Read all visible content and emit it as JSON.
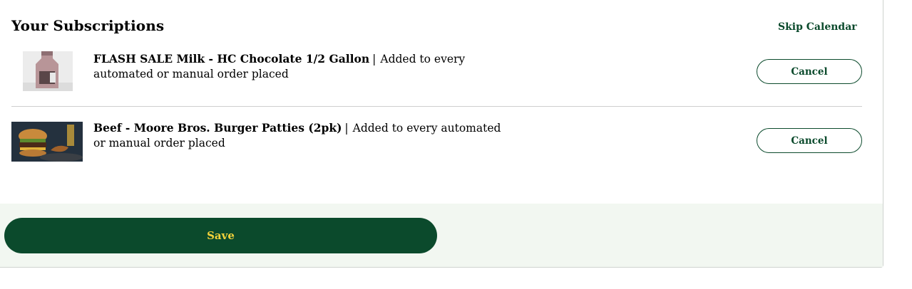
{
  "header": {
    "title": "Your Subscriptions",
    "skip_calendar_label": "Skip Calendar"
  },
  "subscriptions": [
    {
      "product_name": "FLASH SALE Milk - HC Chocolate 1/2 Gallon",
      "separator": "|",
      "frequency_line1": "Added to every",
      "frequency_line2": "automated or manual order placed",
      "cancel_label": "Cancel",
      "image_icon": "milk-jug-photo"
    },
    {
      "product_name": "Beef - Moore Bros. Burger Patties (2pk)",
      "separator": "|",
      "frequency_line1": "Added to every automated",
      "frequency_line2": "or manual order placed",
      "cancel_label": "Cancel",
      "image_icon": "burger-photo"
    }
  ],
  "footer": {
    "save_label": "Save"
  },
  "colors": {
    "brand_green": "#0b4a2c",
    "save_text_yellow": "#f3d23b",
    "footer_bg": "#f2f7f1"
  }
}
